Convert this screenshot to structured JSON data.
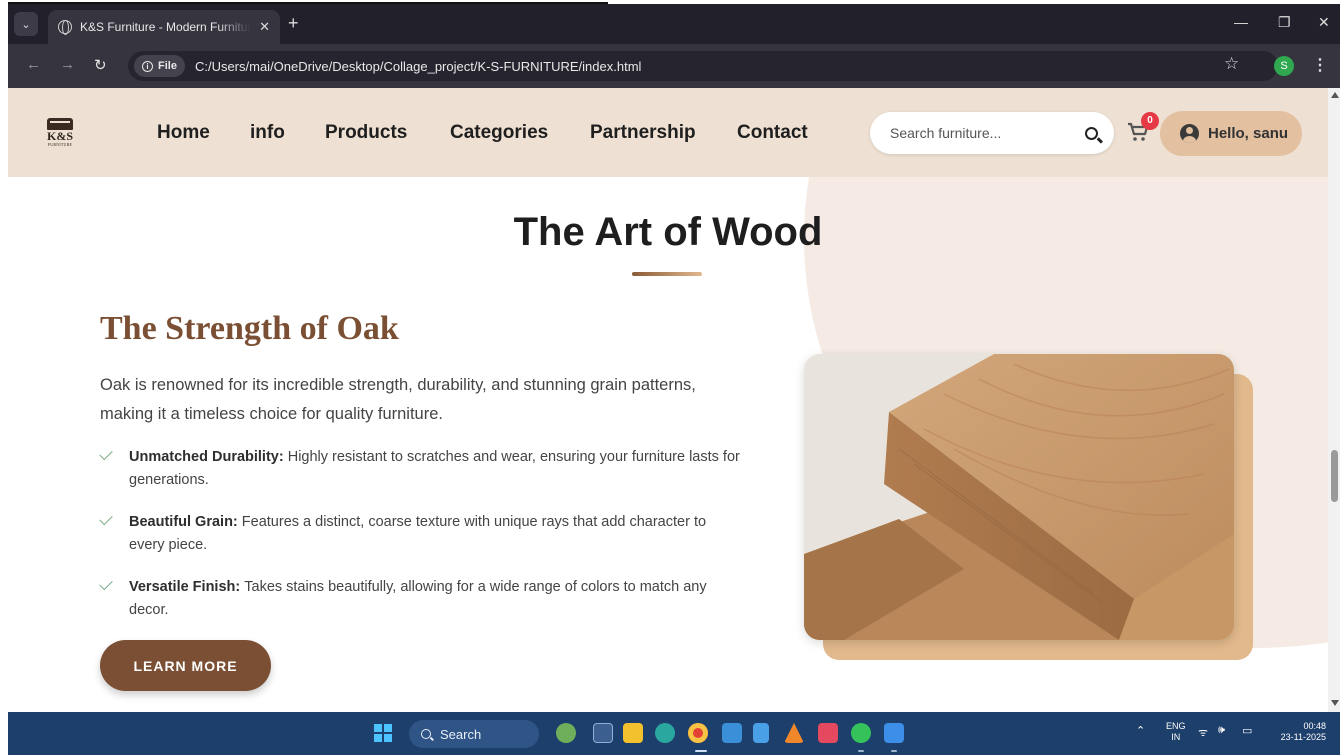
{
  "browser": {
    "tab_title": "K&S Furniture - Modern Furniture",
    "url": "C:/Users/mai/OneDrive/Desktop/Collage_project/K-S-FURNITURE/index.html",
    "file_chip": "File",
    "profile_initial": "S"
  },
  "header": {
    "logo_brand": "K&S",
    "logo_sub": "FURNITURE",
    "nav": [
      "Home",
      "info",
      "Products",
      "Categories",
      "Partnership",
      "Contact"
    ],
    "search_placeholder": "Search furniture...",
    "cart_count": "0",
    "greeting": "Hello, sanu"
  },
  "section": {
    "title": "The Art of Wood",
    "wood_title": "The Strength of Oak",
    "description": "Oak is renowned for its incredible strength, durability, and stunning grain patterns, making it a timeless choice for quality furniture.",
    "features": [
      {
        "label": "Unmatched Durability:",
        "text": "Highly resistant to scratches and wear, ensuring your furniture lasts for generations."
      },
      {
        "label": "Beautiful Grain:",
        "text": "Features a distinct, coarse texture with unique rays that add character to every piece."
      },
      {
        "label": "Versatile Finish:",
        "text": "Takes stains beautifully, allowing for a wide range of colors to match any decor."
      }
    ],
    "button": "LEARN MORE"
  },
  "taskbar": {
    "search": "Search",
    "lang": "ENG",
    "region": "IN",
    "time": "00:48",
    "date": "23-11-2025"
  },
  "colors": {
    "header_bg": "#eee0d2",
    "accent_brown": "#7a4f34",
    "pill_tan": "#e2c0a0",
    "badge_red": "#e53945"
  }
}
